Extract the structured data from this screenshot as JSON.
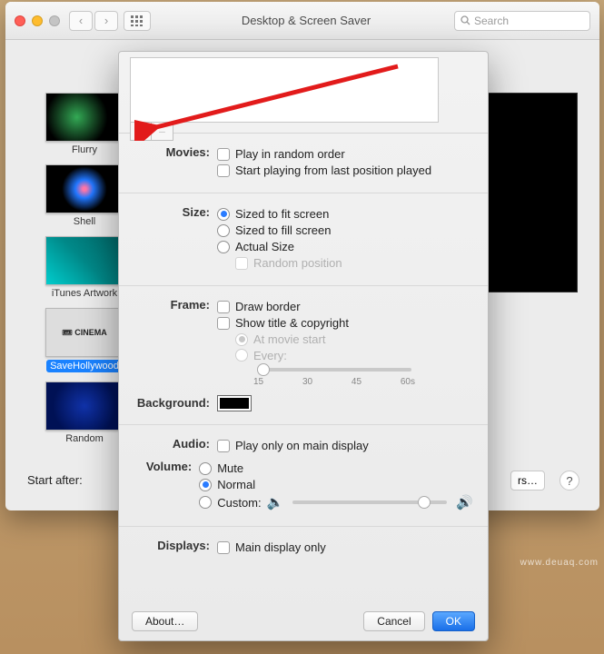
{
  "window": {
    "title": "Desktop & Screen Saver",
    "search_placeholder": "Search",
    "start_after_label": "Start after:",
    "hot_corners_suffix": "rs…",
    "help": "?"
  },
  "savers": [
    {
      "name": "Flurry"
    },
    {
      "name": "Shell"
    },
    {
      "name": "iTunes Artwork"
    },
    {
      "name": "SaveHollywood"
    },
    {
      "name": "Random"
    }
  ],
  "sheet": {
    "movies": {
      "label": "Movies:",
      "random": "Play in random order",
      "resume": "Start playing from last position played"
    },
    "size": {
      "label": "Size:",
      "fit": "Sized to fit screen",
      "fill": "Sized to fill screen",
      "actual": "Actual Size",
      "random_pos": "Random position"
    },
    "frame": {
      "label": "Frame:",
      "border": "Draw border",
      "title": "Show title & copyright",
      "at_start": "At movie start",
      "every": "Every:",
      "ticks": [
        "15",
        "30",
        "45",
        "60s"
      ]
    },
    "background": {
      "label": "Background:"
    },
    "audio": {
      "label": "Audio:",
      "main_only": "Play only on main display"
    },
    "volume": {
      "label": "Volume:",
      "mute": "Mute",
      "normal": "Normal",
      "custom": "Custom:"
    },
    "displays": {
      "label": "Displays:",
      "main_only": "Main display only"
    },
    "buttons": {
      "about": "About…",
      "cancel": "Cancel",
      "ok": "OK"
    }
  },
  "watermark": "www.deuaq.com"
}
